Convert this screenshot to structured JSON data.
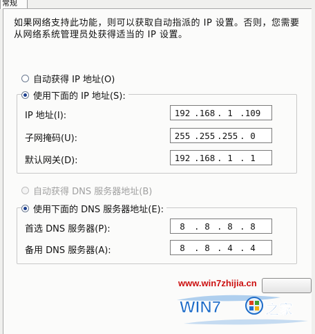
{
  "tab": {
    "label": "常规"
  },
  "description": "如果网络支持此功能，则可以获取自动指派的 IP 设置。否则，您需要从网络系统管理员处获得适当的 IP 设置。",
  "ip_section": {
    "auto_label": "自动获得 IP 地址(O)",
    "manual_label": "使用下面的 IP 地址(S):",
    "selected": "manual",
    "fields": [
      {
        "label": "IP 地址(I):",
        "octets": [
          "192",
          "168",
          "1",
          "109"
        ]
      },
      {
        "label": "子网掩码(U):",
        "octets": [
          "255",
          "255",
          "255",
          "0"
        ]
      },
      {
        "label": "默认网关(D):",
        "octets": [
          "192",
          "168",
          "1",
          "1"
        ]
      }
    ]
  },
  "dns_section": {
    "auto_label": "自动获得 DNS 服务器地址(B)",
    "manual_label": "使用下面的 DNS 服务器地址(E):",
    "selected": "manual",
    "auto_disabled": true,
    "fields": [
      {
        "label": "首选 DNS 服务器(P):",
        "octets": [
          "8",
          "8",
          "8",
          "8"
        ]
      },
      {
        "label": "备用 DNS 服务器(A):",
        "octets": [
          "8",
          "8",
          "4",
          "4"
        ]
      }
    ]
  },
  "watermark": {
    "url": "www.win7zhijia.cn",
    "logo_text": "WIN7",
    "logo_suffix": "之家"
  },
  "colors": {
    "panel_bg": "#fbfbfa",
    "radio_dot": "#1c3f8f",
    "watermark_red": "#cc1010",
    "logo_blue": "#1e6cc8"
  }
}
